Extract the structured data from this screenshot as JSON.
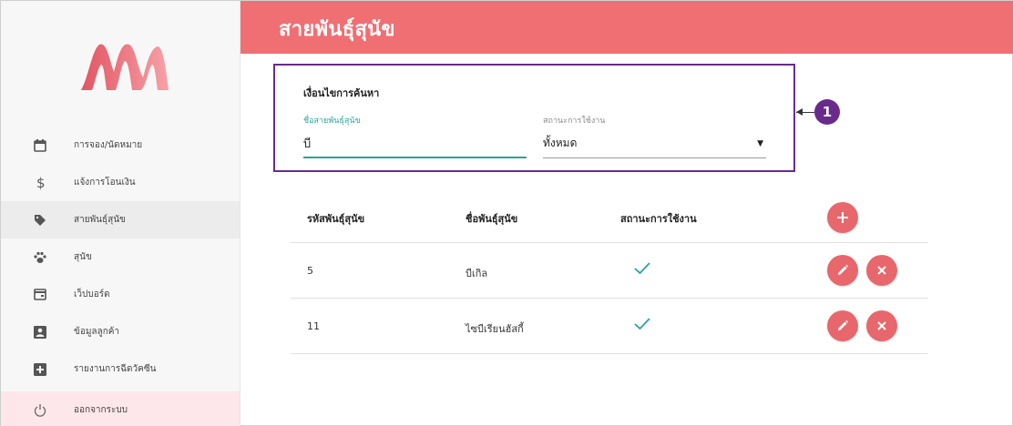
{
  "app": {
    "logo_icon": "m-logo-icon",
    "accent": "#ef6f73",
    "sidebar_bg": "#f7f7f7"
  },
  "sidebar": {
    "items": [
      {
        "label": "การจอง/นัดหมาย",
        "icon": "calendar-icon"
      },
      {
        "label": "แจ้งการโอนเงิน",
        "icon": "dollar-icon"
      },
      {
        "label": "สายพันธุ์สุนัข",
        "icon": "tag-icon"
      },
      {
        "label": "สุนัข",
        "icon": "paw-icon"
      },
      {
        "label": "เว็ปบอร์ด",
        "icon": "webboard-icon"
      },
      {
        "label": "ข้อมูลลูกค้า",
        "icon": "account-box-icon"
      },
      {
        "label": "รายงานการฉีดวัคซีน",
        "icon": "plus-box-icon"
      },
      {
        "label": "ออกจากระบบ",
        "icon": "power-icon"
      }
    ]
  },
  "header": {
    "title": "สายพันธุ์สุนัข"
  },
  "search": {
    "title": "เงื่อนไขการค้นหา",
    "name_label": "ชื่อสายพันธุ์สุนัข",
    "name_value": "บี",
    "status_label": "สถานะการใช้งาน",
    "status_value": "ทั้งหมด",
    "callout_number": "1",
    "border_color": "#6a2a8c"
  },
  "table": {
    "columns": [
      "รหัสพันธุ์สุนัข",
      "ชื่อพันธุ์สุนัข",
      "สถานะการใช้งาน"
    ],
    "rows": [
      {
        "id": "5",
        "name": "บีเกิล",
        "active": true
      },
      {
        "id": "11",
        "name": "ไซบีเรียนฮัสกี้",
        "active": true
      }
    ],
    "check_color": "#2aa39a",
    "button_color": "#e8676c"
  }
}
